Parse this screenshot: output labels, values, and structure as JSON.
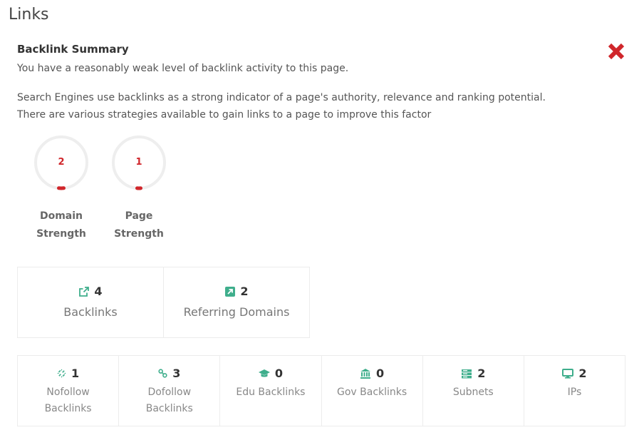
{
  "section": {
    "title": "Links"
  },
  "summary": {
    "heading": "Backlink Summary",
    "status": "You have a reasonably weak level of backlink activity to this page.",
    "description": "Search Engines use backlinks as a strong indicator of a page's authority, relevance and ranking potential. There are various strategies available to gain links to a page to improve this factor",
    "status_icon": "close-icon",
    "status_color": "#d0262b"
  },
  "gauges": [
    {
      "value": "2",
      "label": "Domain\nStrength"
    },
    {
      "value": "1",
      "label": "Page\nStrength"
    }
  ],
  "primary_stats": [
    {
      "icon": "external-link-icon",
      "value": "4",
      "label": "Backlinks"
    },
    {
      "icon": "arrow-up-right-icon",
      "value": "2",
      "label": "Referring Domains"
    }
  ],
  "secondary_stats": [
    {
      "icon": "unlink-icon",
      "value": "1",
      "label": "Nofollow\nBacklinks"
    },
    {
      "icon": "link-icon",
      "value": "3",
      "label": "Dofollow\nBacklinks"
    },
    {
      "icon": "graduation-cap-icon",
      "value": "0",
      "label": "Edu Backlinks"
    },
    {
      "icon": "bank-icon",
      "value": "0",
      "label": "Gov Backlinks"
    },
    {
      "icon": "server-icon",
      "value": "2",
      "label": "Subnets"
    },
    {
      "icon": "monitor-icon",
      "value": "2",
      "label": "IPs"
    }
  ],
  "colors": {
    "accent": "#3fae8c",
    "danger": "#d0262b",
    "gauge_track": "#eeeeee"
  }
}
